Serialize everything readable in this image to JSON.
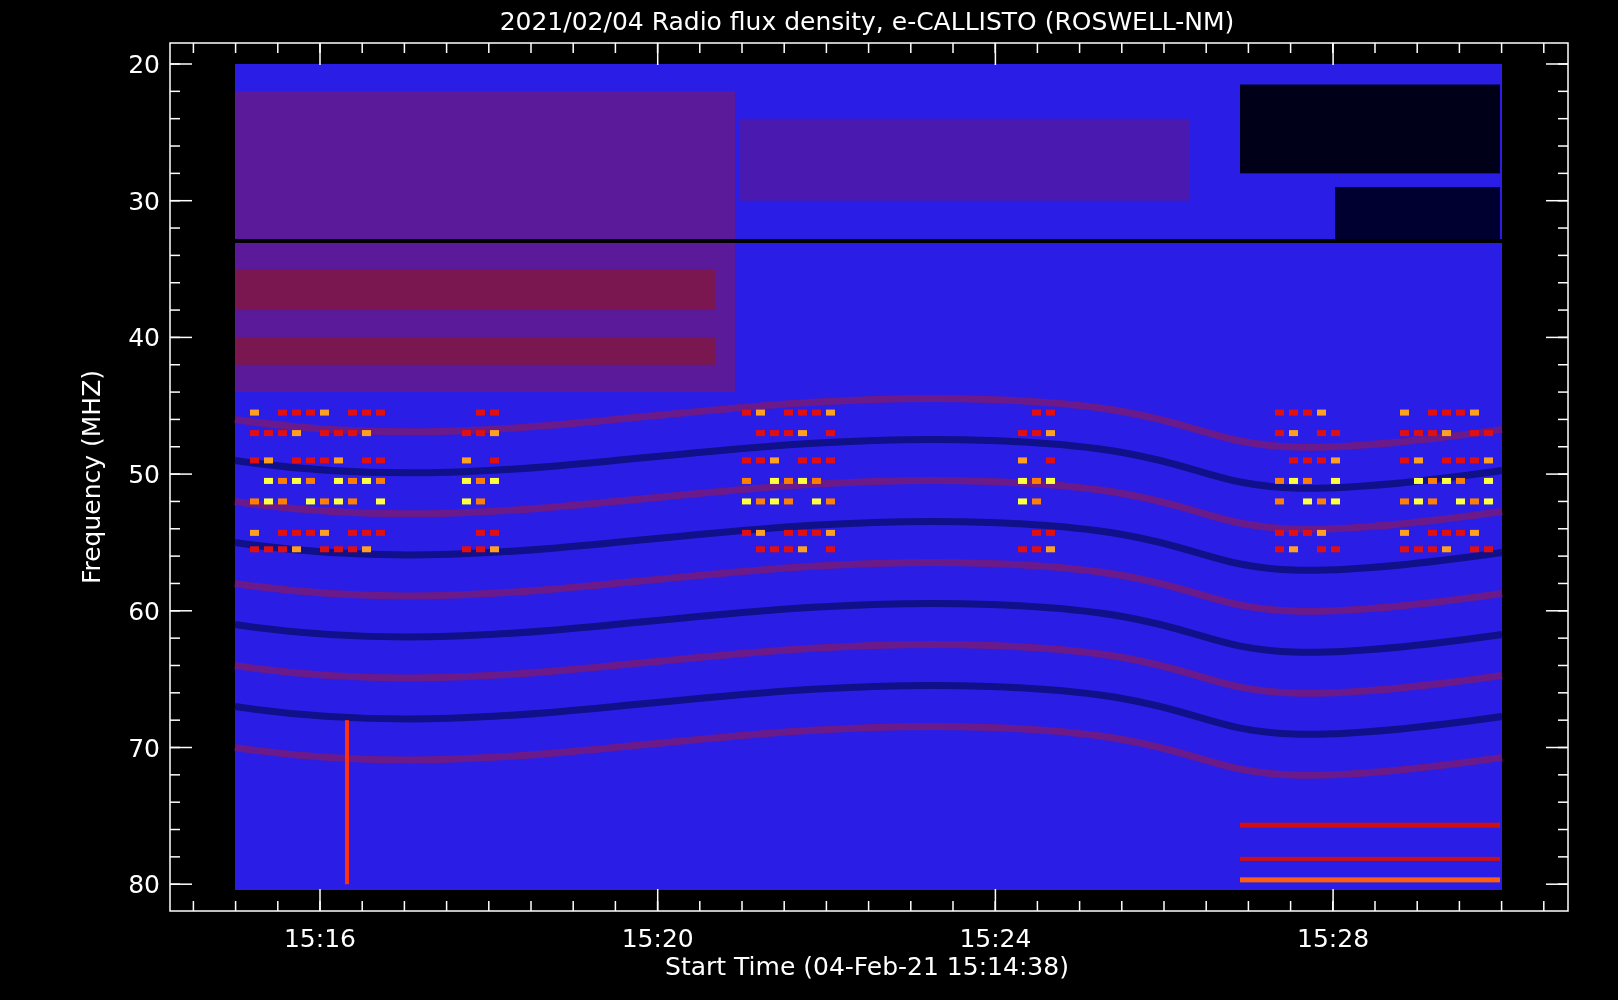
{
  "chart": {
    "title": "2021/02/04  Radio flux density, e-CALLISTO (ROSWELL-NM)",
    "ylabel": "Frequency (MHZ)",
    "xlabel": "Start Time (04-Feb-21 15:14:38)",
    "yticks": [
      "20",
      "30",
      "40",
      "50",
      "60",
      "70",
      "80"
    ],
    "xticks": [
      "15:16",
      "15:20",
      "15:24",
      "15:28"
    ]
  }
}
